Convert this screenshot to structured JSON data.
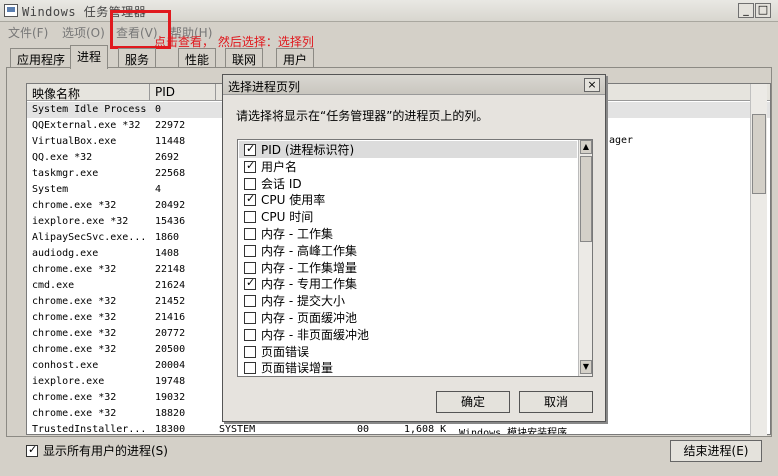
{
  "window": {
    "title": "Windows 任务管理器",
    "min_label": "_",
    "max_label": "□"
  },
  "menu": {
    "items": [
      "文件(F)",
      "选项(O)",
      "查看(V)",
      "帮助(H)"
    ]
  },
  "annotation": "点击查看， 然后选择：选择列",
  "tabs": [
    "应用程序",
    "进程",
    "服务",
    "性能",
    "联网",
    "用户"
  ],
  "active_tab": "进程",
  "process_list": {
    "headers": [
      "映像名称",
      "PID"
    ],
    "rows": [
      {
        "name": "System Idle Process",
        "pid": "0",
        "user": "",
        "cpu": "",
        "mem": "",
        "desc": ""
      },
      {
        "name": "QQExternal.exe *32",
        "pid": "22972",
        "user": "",
        "cpu": "",
        "mem": "",
        "desc": ""
      },
      {
        "name": "VirtualBox.exe",
        "pid": "11448",
        "user": "",
        "cpu": "",
        "mem": "",
        "desc": ""
      },
      {
        "name": "QQ.exe *32",
        "pid": "2692",
        "user": "",
        "cpu": "",
        "mem": "",
        "desc": ""
      },
      {
        "name": "taskmgr.exe",
        "pid": "22568",
        "user": "",
        "cpu": "",
        "mem": "",
        "desc": ""
      },
      {
        "name": "System",
        "pid": "4",
        "user": "",
        "cpu": "",
        "mem": "",
        "desc": ""
      },
      {
        "name": "chrome.exe *32",
        "pid": "20492",
        "user": "",
        "cpu": "",
        "mem": "",
        "desc": ""
      },
      {
        "name": "iexplore.exe *32",
        "pid": "15436",
        "user": "",
        "cpu": "",
        "mem": "",
        "desc": ""
      },
      {
        "name": "AlipaySecSvc.exe...",
        "pid": "1860",
        "user": "",
        "cpu": "",
        "mem": "",
        "desc": ""
      },
      {
        "name": "audiodg.exe",
        "pid": "1408",
        "user": "",
        "cpu": "",
        "mem": "",
        "desc": ""
      },
      {
        "name": "chrome.exe *32",
        "pid": "22148",
        "user": "",
        "cpu": "",
        "mem": "",
        "desc": ""
      },
      {
        "name": "cmd.exe",
        "pid": "21624",
        "user": "",
        "cpu": "",
        "mem": "",
        "desc": ""
      },
      {
        "name": "chrome.exe *32",
        "pid": "21452",
        "user": "",
        "cpu": "",
        "mem": "",
        "desc": ""
      },
      {
        "name": "chrome.exe *32",
        "pid": "21416",
        "user": "",
        "cpu": "",
        "mem": "",
        "desc": ""
      },
      {
        "name": "chrome.exe *32",
        "pid": "20772",
        "user": "",
        "cpu": "",
        "mem": "",
        "desc": ""
      },
      {
        "name": "chrome.exe *32",
        "pid": "20500",
        "user": "",
        "cpu": "",
        "mem": "",
        "desc": ""
      },
      {
        "name": "conhost.exe",
        "pid": "20004",
        "user": "",
        "cpu": "",
        "mem": "",
        "desc": ""
      },
      {
        "name": "iexplore.exe",
        "pid": "19748",
        "user": "",
        "cpu": "",
        "mem": "",
        "desc": ""
      },
      {
        "name": "chrome.exe *32",
        "pid": "19032",
        "user": "",
        "cpu": "",
        "mem": "",
        "desc": ""
      },
      {
        "name": "chrome.exe *32",
        "pid": "18820",
        "user": "",
        "cpu": "",
        "mem": "",
        "desc": ""
      },
      {
        "name": "TrustedInstaller...",
        "pid": "18300",
        "user": "SYSTEM",
        "cpu": "00",
        "mem": "1,608 K",
        "desc": "Windows 模块安装程序"
      }
    ],
    "right_fragment": "ager"
  },
  "show_all_label": "显示所有用户的进程(S)",
  "end_process_label": "结束进程(E)",
  "dialog": {
    "title": "选择进程页列",
    "close_label": "×",
    "message": "请选择将显示在“任务管理器”的进程页上的列。",
    "columns": [
      {
        "label": "PID (进程标识符)",
        "checked": true
      },
      {
        "label": "用户名",
        "checked": true
      },
      {
        "label": "会话 ID",
        "checked": false
      },
      {
        "label": "CPU 使用率",
        "checked": true
      },
      {
        "label": "CPU 时间",
        "checked": false
      },
      {
        "label": "内存 - 工作集",
        "checked": false
      },
      {
        "label": "内存 - 高峰工作集",
        "checked": false
      },
      {
        "label": "内存 - 工作集增量",
        "checked": false
      },
      {
        "label": "内存 - 专用工作集",
        "checked": true
      },
      {
        "label": "内存 - 提交大小",
        "checked": false
      },
      {
        "label": "内存 - 页面缓冲池",
        "checked": false
      },
      {
        "label": "内存 - 非页面缓冲池",
        "checked": false
      },
      {
        "label": "页面错误",
        "checked": false
      },
      {
        "label": "页面错误增量",
        "checked": false
      }
    ],
    "ok_label": "确定",
    "cancel_label": "取消"
  },
  "colors": {
    "annotation": "#e0191e",
    "selection": "#dcdcdc"
  }
}
